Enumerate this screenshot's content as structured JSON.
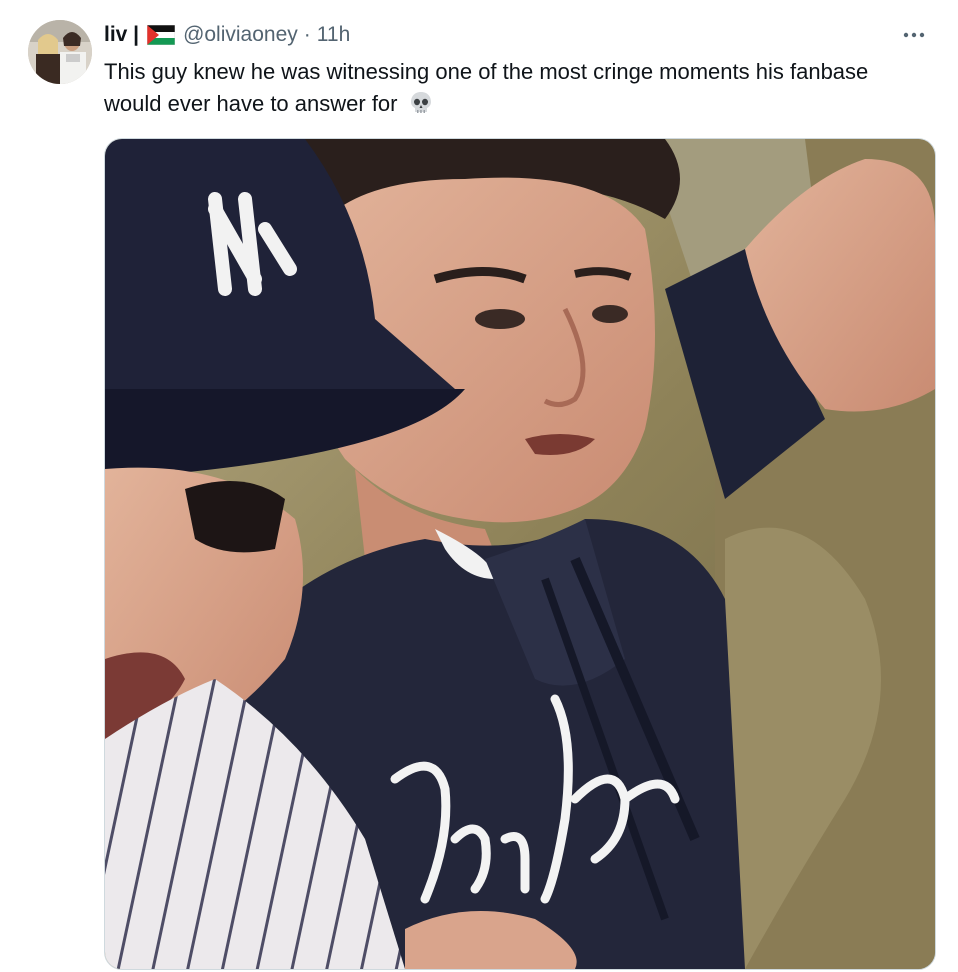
{
  "tweet": {
    "display_name": "liv |",
    "flag_icon": "palestine-flag-icon",
    "handle": "@oliviaoney",
    "separator": "·",
    "timestamp": "11h",
    "more_icon": "more-horizontal-icon",
    "text": "This guy knew he was witnessing one of the most cringe moments his fanbase would ever have to answer for",
    "emoji": "skull-emoji",
    "media": {
      "alt_icon": "photo"
    }
  }
}
